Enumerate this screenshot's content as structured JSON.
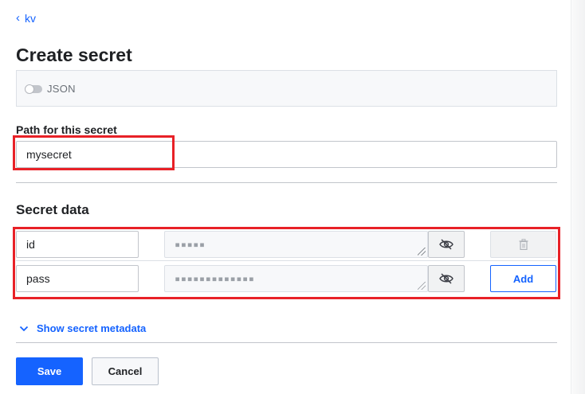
{
  "breadcrumb": {
    "label": "kv"
  },
  "page": {
    "title": "Create secret"
  },
  "json_toggle": {
    "label": "JSON",
    "enabled": false
  },
  "path": {
    "label": "Path for this secret",
    "value": "mysecret"
  },
  "secret_data": {
    "title": "Secret data",
    "rows": [
      {
        "key": "id",
        "masked_value": "▪▪▪▪▪",
        "action": "delete"
      },
      {
        "key": "pass",
        "masked_value": "▪▪▪▪▪▪▪▪▪▪▪▪▪",
        "action": "Add"
      }
    ]
  },
  "metadata_toggle": {
    "label": "Show secret metadata"
  },
  "actions": {
    "save_label": "Save",
    "cancel_label": "Cancel"
  },
  "colors": {
    "accent": "#1563ff",
    "highlight": "#e82127",
    "text": "#1f2124"
  },
  "icons": {
    "back": "chevron-left-icon",
    "reveal": "eye-off-icon",
    "delete": "trash-icon",
    "expand": "chevron-down-icon"
  }
}
